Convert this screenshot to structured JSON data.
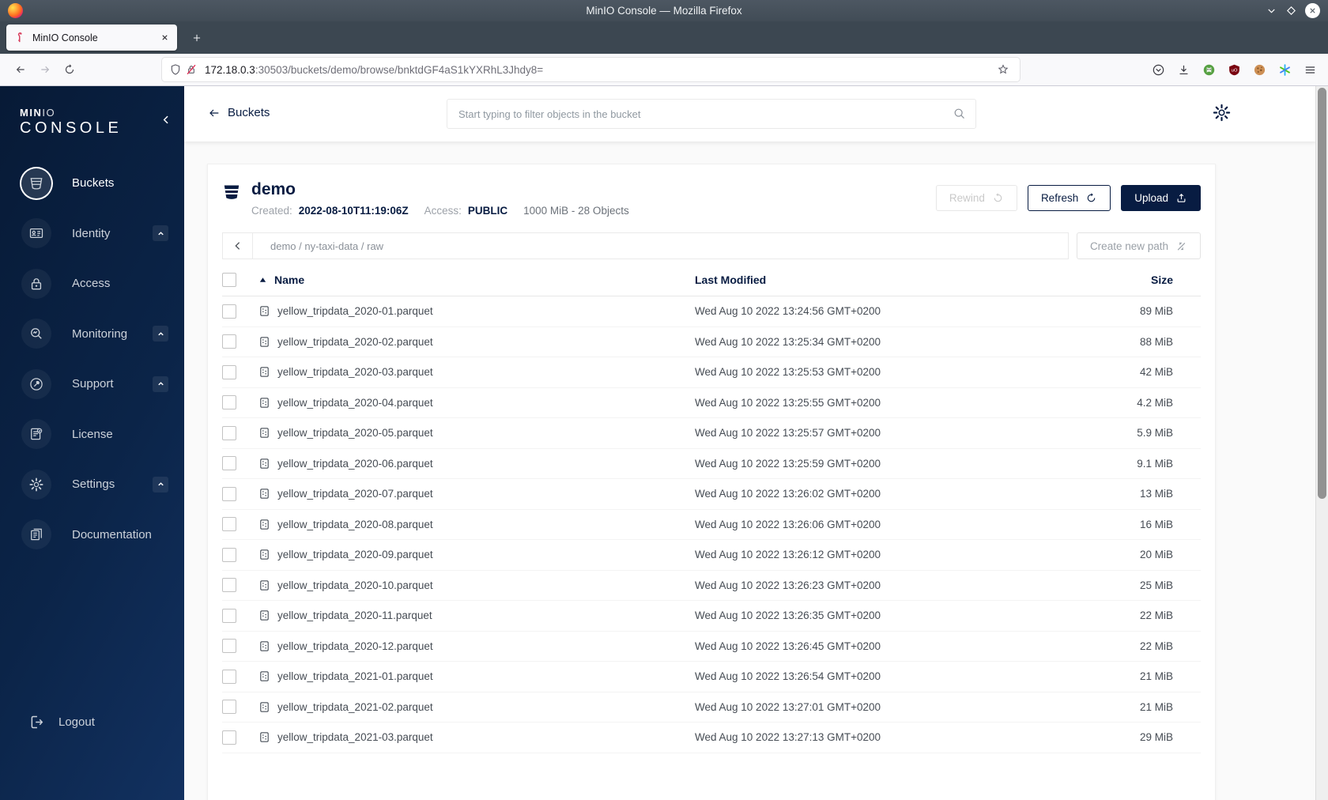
{
  "window": {
    "title": "MinIO Console — Mozilla Firefox",
    "tab": {
      "title": "MinIO Console"
    },
    "url": {
      "host": "172.18.0.3",
      "path": ":30503/buckets/demo/browse/bnktdGF4aS1kYXRhL3Jhdy8="
    }
  },
  "sidebar": {
    "logo_bold": "MIN",
    "logo_light": "IO",
    "logo_line2": "CONSOLE",
    "items": [
      {
        "label": "Buckets",
        "icon": "buckets-icon",
        "active": true,
        "expandable": false
      },
      {
        "label": "Identity",
        "icon": "identity-icon",
        "active": false,
        "expandable": true
      },
      {
        "label": "Access",
        "icon": "access-icon",
        "active": false,
        "expandable": false
      },
      {
        "label": "Monitoring",
        "icon": "monitoring-icon",
        "active": false,
        "expandable": true
      },
      {
        "label": "Support",
        "icon": "support-icon",
        "active": false,
        "expandable": true
      },
      {
        "label": "License",
        "icon": "license-icon",
        "active": false,
        "expandable": false
      },
      {
        "label": "Settings",
        "icon": "settings-icon",
        "active": false,
        "expandable": true
      },
      {
        "label": "Documentation",
        "icon": "documentation-icon",
        "active": false,
        "expandable": false
      }
    ],
    "logout": {
      "label": "Logout",
      "icon": "logout-icon"
    }
  },
  "topbar": {
    "back_label": "Buckets",
    "search_placeholder": "Start typing to filter objects in the bucket"
  },
  "bucket_header": {
    "name": "demo",
    "created_label": "Created:",
    "created": "2022-08-10T11:19:06Z",
    "access_label": "Access:",
    "access": "PUBLIC",
    "summary": "1000 MiB - 28 Objects",
    "buttons": {
      "rewind": "Rewind",
      "refresh": "Refresh",
      "upload": "Upload"
    }
  },
  "browse": {
    "breadcrumb": "demo / ny-taxi-data / raw",
    "create_path_label": "Create new path"
  },
  "table": {
    "headers": {
      "name": "Name",
      "modified": "Last Modified",
      "size": "Size"
    },
    "rows": [
      {
        "name": "yellow_tripdata_2020-01.parquet",
        "modified": "Wed Aug 10 2022 13:24:56 GMT+0200",
        "size": "89 MiB"
      },
      {
        "name": "yellow_tripdata_2020-02.parquet",
        "modified": "Wed Aug 10 2022 13:25:34 GMT+0200",
        "size": "88 MiB"
      },
      {
        "name": "yellow_tripdata_2020-03.parquet",
        "modified": "Wed Aug 10 2022 13:25:53 GMT+0200",
        "size": "42 MiB"
      },
      {
        "name": "yellow_tripdata_2020-04.parquet",
        "modified": "Wed Aug 10 2022 13:25:55 GMT+0200",
        "size": "4.2 MiB"
      },
      {
        "name": "yellow_tripdata_2020-05.parquet",
        "modified": "Wed Aug 10 2022 13:25:57 GMT+0200",
        "size": "5.9 MiB"
      },
      {
        "name": "yellow_tripdata_2020-06.parquet",
        "modified": "Wed Aug 10 2022 13:25:59 GMT+0200",
        "size": "9.1 MiB"
      },
      {
        "name": "yellow_tripdata_2020-07.parquet",
        "modified": "Wed Aug 10 2022 13:26:02 GMT+0200",
        "size": "13 MiB"
      },
      {
        "name": "yellow_tripdata_2020-08.parquet",
        "modified": "Wed Aug 10 2022 13:26:06 GMT+0200",
        "size": "16 MiB"
      },
      {
        "name": "yellow_tripdata_2020-09.parquet",
        "modified": "Wed Aug 10 2022 13:26:12 GMT+0200",
        "size": "20 MiB"
      },
      {
        "name": "yellow_tripdata_2020-10.parquet",
        "modified": "Wed Aug 10 2022 13:26:23 GMT+0200",
        "size": "25 MiB"
      },
      {
        "name": "yellow_tripdata_2020-11.parquet",
        "modified": "Wed Aug 10 2022 13:26:35 GMT+0200",
        "size": "22 MiB"
      },
      {
        "name": "yellow_tripdata_2020-12.parquet",
        "modified": "Wed Aug 10 2022 13:26:45 GMT+0200",
        "size": "22 MiB"
      },
      {
        "name": "yellow_tripdata_2021-01.parquet",
        "modified": "Wed Aug 10 2022 13:26:54 GMT+0200",
        "size": "21 MiB"
      },
      {
        "name": "yellow_tripdata_2021-02.parquet",
        "modified": "Wed Aug 10 2022 13:27:01 GMT+0200",
        "size": "21 MiB"
      },
      {
        "name": "yellow_tripdata_2021-03.parquet",
        "modified": "Wed Aug 10 2022 13:27:13 GMT+0200",
        "size": "29 MiB"
      }
    ]
  },
  "colors": {
    "minio_navy": "#081C42",
    "minio_red": "#C72C48",
    "sidebar_gradient_start": "#071a36",
    "sidebar_gradient_end": "#123160",
    "page_background": "#fafafa",
    "disabled_text": "#c9c9c9",
    "titlebar": "#414c56"
  }
}
